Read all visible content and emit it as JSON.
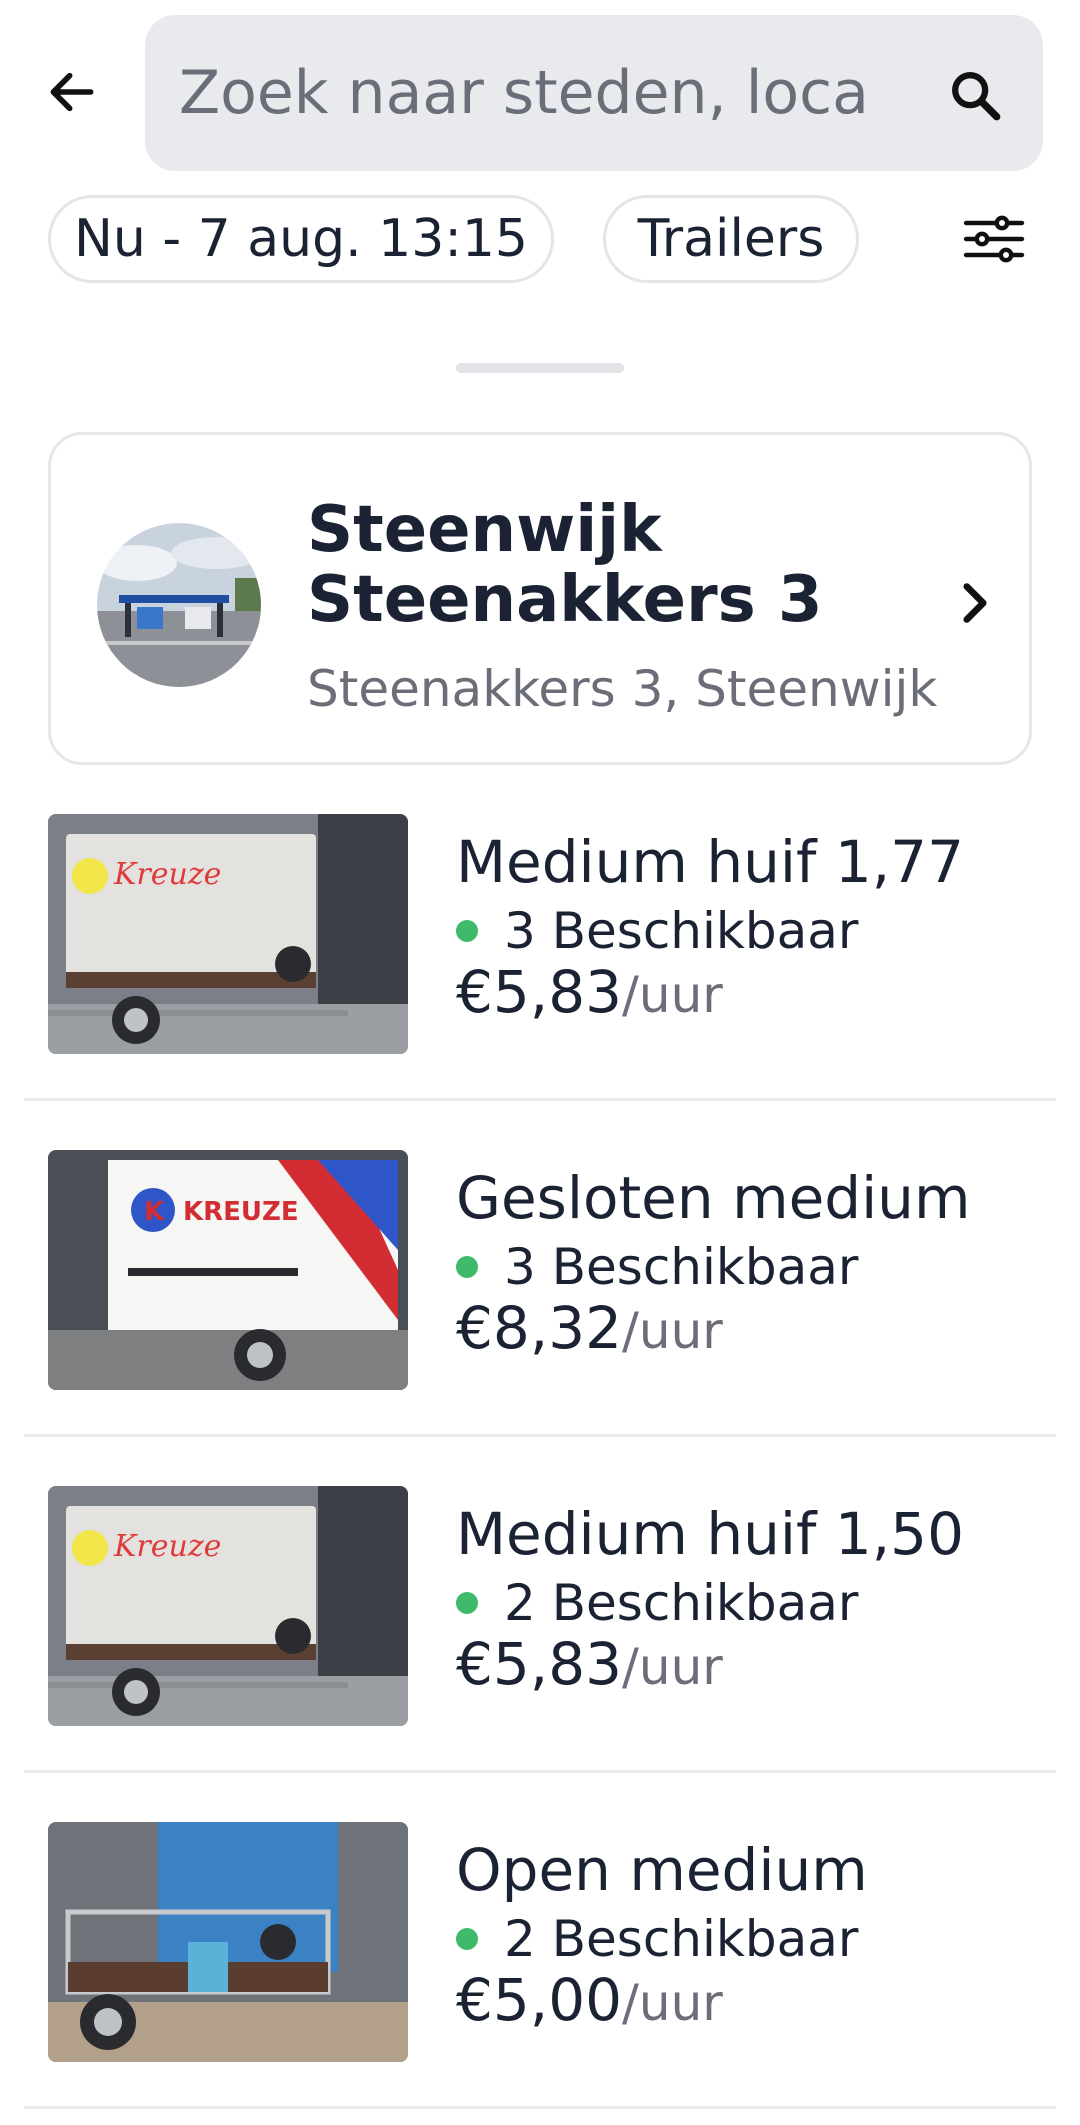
{
  "header": {
    "back_icon": "arrow-left-icon",
    "search_placeholder": "Zoek naar steden, loca",
    "search_icon": "magnifier-icon"
  },
  "filters": {
    "date_label": "Nu - 7 aug. 13:15",
    "type_label": "Trailers",
    "filter_icon": "sliders-icon"
  },
  "location": {
    "title": "Steenwijk Steenakkers 3",
    "address": "Steenakkers 3, Steenwijk",
    "chevron_icon": "chevron-right-icon"
  },
  "colors": {
    "available_dot": "#3dbb6b",
    "text": "#1b2233",
    "muted": "#6b6e78",
    "search_bg": "#e9eaee"
  },
  "items": [
    {
      "name": "Medium huif 1,77",
      "availability": "3 Beschikbaar",
      "price": "€5,83",
      "unit": "/uur",
      "thumb": "trailer-covered"
    },
    {
      "name": "Gesloten medium",
      "availability": "3 Beschikbaar",
      "price": "€8,32",
      "unit": "/uur",
      "thumb": "trailer-closed"
    },
    {
      "name": "Medium huif 1,50",
      "availability": "2 Beschikbaar",
      "price": "€5,83",
      "unit": "/uur",
      "thumb": "trailer-covered"
    },
    {
      "name": "Open medium",
      "availability": "2 Beschikbaar",
      "price": "€5,00",
      "unit": "/uur",
      "thumb": "trailer-open"
    }
  ]
}
